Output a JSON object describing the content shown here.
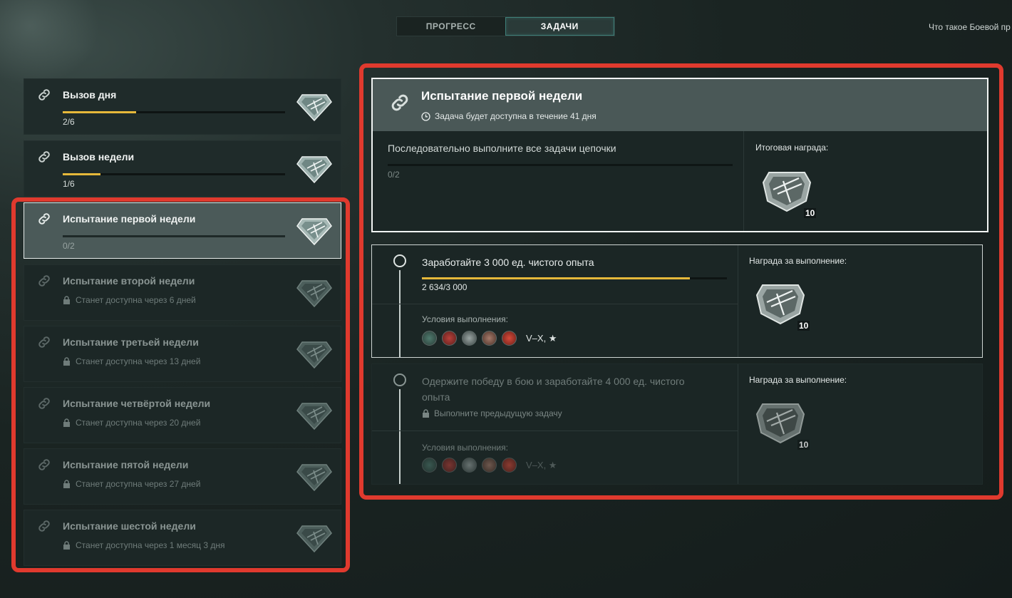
{
  "tabs": {
    "progress": "ПРОГРЕСС",
    "tasks": "ЗАДАЧИ"
  },
  "help_link": "Что такое Боевой пр",
  "colors": {
    "accent_progress": "#e6b83a",
    "highlight": "#e03a2e",
    "active_tab": "#3e7f78"
  },
  "challenges": [
    {
      "title": "Вызов дня",
      "count": "2/6",
      "progress": 0.33,
      "state": "active",
      "icon": "link-icon",
      "reward_icon": "diamond-badge-icon"
    },
    {
      "title": "Вызов недели",
      "count": "1/6",
      "progress": 0.17,
      "state": "active",
      "icon": "link-icon",
      "reward_icon": "diamond-badge-icon"
    },
    {
      "title": "Испытание первой недели",
      "count": "0/2",
      "progress": 0,
      "state": "selected",
      "icon": "link-icon",
      "reward_icon": "diamond-badge-icon"
    },
    {
      "title": "Испытание второй недели",
      "sub": "Станет доступна через 6 дней",
      "state": "locked",
      "icon": "link-icon",
      "reward_icon": "diamond-badge-icon"
    },
    {
      "title": "Испытание третьей недели",
      "sub": "Станет доступна через 13 дней",
      "state": "locked",
      "icon": "link-icon",
      "reward_icon": "diamond-badge-icon"
    },
    {
      "title": "Испытание четвёртой недели",
      "sub": "Станет доступна через 20 дней",
      "state": "locked",
      "icon": "link-icon",
      "reward_icon": "diamond-badge-icon"
    },
    {
      "title": "Испытание пятой недели",
      "sub": "Станет доступна через 27 дней",
      "state": "locked",
      "icon": "link-icon",
      "reward_icon": "diamond-badge-icon"
    },
    {
      "title": "Испытание шестой недели",
      "sub": "Станет доступна через 1 месяц 3 дня",
      "state": "locked",
      "icon": "link-icon",
      "reward_icon": "diamond-badge-icon"
    }
  ],
  "detail": {
    "title": "Испытание первой недели",
    "timer": "Задача будет доступна в течение 41 дня",
    "description": "Последовательно выполните все задачи цепочки",
    "count": "0/2",
    "progress": 0,
    "reward_label": "Итоговая награда:",
    "reward_qty": "10"
  },
  "tasks": [
    {
      "title": "Заработайте 3 000 ед. чистого опыта",
      "count": "2 634/3 000",
      "progress": 0.878,
      "conditions_label": "Условия выполнения:",
      "tiers": "V–X, ★",
      "reward_label": "Награда за выполнение:",
      "reward_qty": "10",
      "state": "active"
    },
    {
      "title": "Одержите победу в бою и заработайте 4 000 ед. чистого опыта",
      "lock_msg": "Выполните предыдущую задачу",
      "conditions_label": "Условия выполнения:",
      "tiers": "V–X, ★",
      "reward_label": "Награда за выполнение:",
      "reward_qty": "10",
      "state": "locked"
    }
  ],
  "nations": [
    "nation-1-icon",
    "nation-2-icon",
    "nation-3-icon",
    "nation-4-icon",
    "nation-5-icon"
  ]
}
